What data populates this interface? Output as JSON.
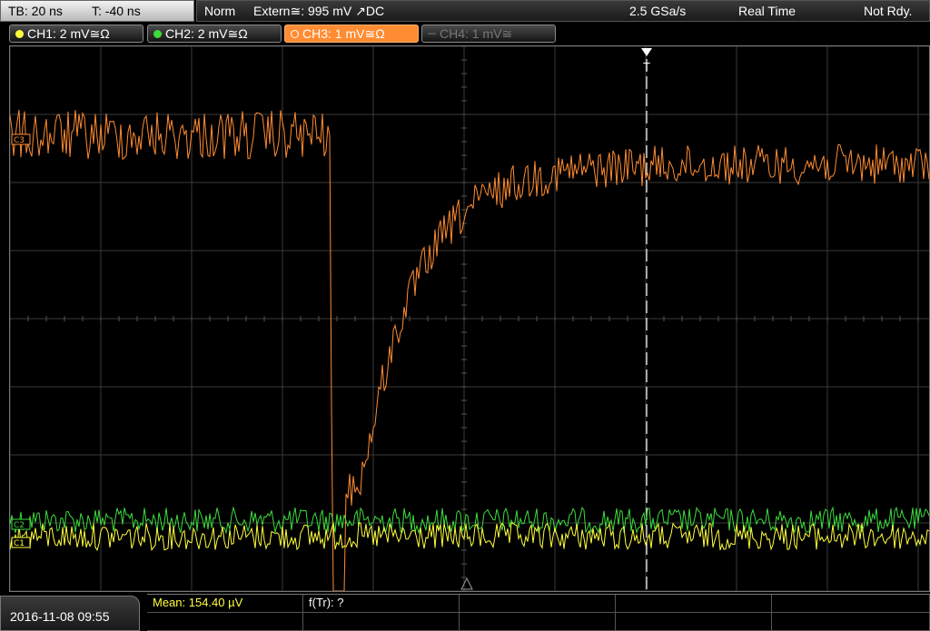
{
  "timebase": {
    "tb": "TB: 20 ns",
    "t": "T: -40 ns"
  },
  "acquisition": {
    "mode": "Norm",
    "trigger": "Extern≅: 995 mV ↗DC",
    "sample_rate": "2.5 GSa/s",
    "realtime": "Real Time",
    "status": "Not Rdy."
  },
  "channels": [
    {
      "label": "CH1: 2 mV≅Ω",
      "color": "#ffff3c",
      "state": "on"
    },
    {
      "label": "CH2: 2 mV≅Ω",
      "color": "#3cdc3c",
      "state": "on"
    },
    {
      "label": "CH3: 1 mV≅Ω",
      "color": "#ff8c32",
      "state": "active"
    },
    {
      "label": "CH4: 1 mV≅",
      "color": "#777777",
      "state": "off"
    }
  ],
  "markers": {
    "trigger": "T",
    "ch3": "C3",
    "ch2": "C2",
    "ch1": "C1"
  },
  "footer": {
    "datetime": "2016-11-08 09:55",
    "meas1": "Mean: 154.40 µV",
    "meas2": "f(Tr): ?"
  },
  "colors": {
    "ch1": "#ffff3c",
    "ch2": "#3cdc3c",
    "ch3": "#ff8c32",
    "grid": "#3a3a3a"
  }
}
